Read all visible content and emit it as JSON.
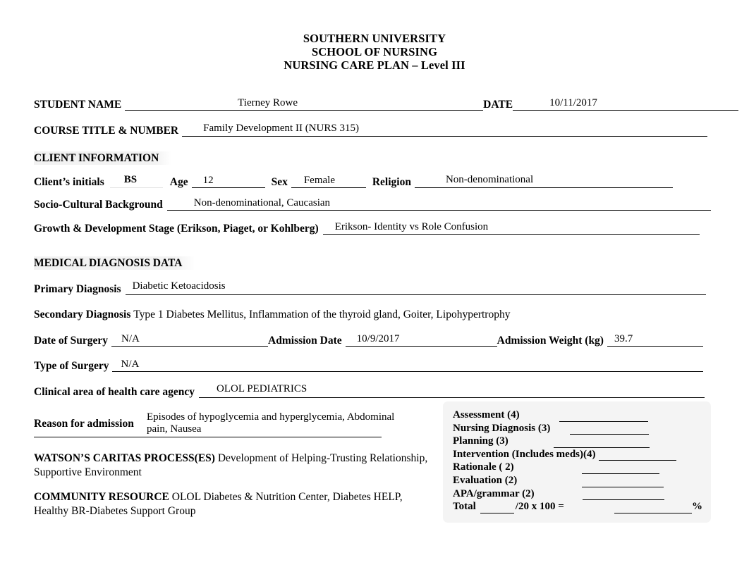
{
  "header": {
    "line1": "SOUTHERN UNIVERSITY",
    "line2": "SCHOOL OF NURSING",
    "line3": "NURSING CARE PLAN – Level III"
  },
  "identity": {
    "student_name_label": "STUDENT NAME",
    "student_name_value": "Tierney Rowe",
    "date_label": "DATE",
    "date_value": "10/11/2017",
    "course_label": "COURSE TITLE & NUMBER",
    "course_value": "Family Development II (NURS 315)"
  },
  "client_information": {
    "section_title": "CLIENT INFORMATION",
    "initials_label": "Client’s initials",
    "initials_value": "BS",
    "age_label": "Age",
    "age_value": "12",
    "sex_label": "Sex",
    "sex_value": "Female",
    "religion_label": "Religion",
    "religion_value": "Non-denominational",
    "socio_label": "Socio-Cultural Background",
    "socio_value": "Non-denominational, Caucasian",
    "growth_label": "Growth & Development Stage (Erikson, Piaget, or Kohlberg)",
    "growth_value": "Erikson- Identity vs Role Confusion"
  },
  "medical_diagnosis": {
    "section_title": "MEDICAL DIAGNOSIS DATA",
    "primary_label": "Primary Diagnosis",
    "primary_value": "Diabetic Ketoacidosis",
    "secondary_label": "Secondary Diagnosis",
    "secondary_value": "Type 1 Diabetes Mellitus, Inflammation of the thyroid gland, Goiter, Lipohypertrophy",
    "date_of_surgery_label": "Date of Surgery",
    "date_of_surgery_value": "N/A",
    "admission_date_label": "Admission Date",
    "admission_date_value": "10/9/2017",
    "admission_weight_label": "Admission Weight (kg)",
    "admission_weight_value": "39.7",
    "type_of_surgery_label": "Type of Surgery",
    "type_of_surgery_value": "N/A",
    "clinical_area_label": "Clinical area of health care agency",
    "clinical_area_value": "OLOL PEDIATRICS",
    "reason_label": "Reason for admission",
    "reason_value_line1": "Episodes of hypoglycemia and hyperglycemia, Abdominal",
    "reason_value_line2": "pain, Nausea"
  },
  "narrative": {
    "watson_label": "WATSON’S CARITAS PROCESS(ES)",
    "watson_value": " Development of Helping-Trusting Relationship, Supportive Environment",
    "community_label": "COMMUNITY RESOURCE",
    "community_value": " OLOL Diabetes & Nutrition Center, Diabetes HELP, Healthy BR-Diabetes Support Group"
  },
  "rubric": {
    "items": [
      {
        "label": "Assessment  (4)",
        "rule_width": 126,
        "gap_before": 56
      },
      {
        "label": "Nursing Diagnosis (3)",
        "rule_width": 112,
        "gap_before": 28
      },
      {
        "label": "Planning (3)",
        "rule_width": 136,
        "gap_before": 64
      },
      {
        "label": "Intervention (Includes meds)(4)",
        "rule_width": 110,
        "gap_before": 4
      },
      {
        "label": "Rationale  ( 2)",
        "rule_width": 110,
        "gap_before": 96
      },
      {
        "label": "Evaluation (2)",
        "rule_width": 116,
        "gap_before": 92
      },
      {
        "label": "APA/grammar (2)",
        "rule_width": 116,
        "gap_before": 68
      }
    ],
    "total_label": "Total",
    "total_rule_width": 48,
    "total_mid": "/20 x 100 =",
    "total_value_rule_width": 110,
    "percent_symbol": "%"
  }
}
